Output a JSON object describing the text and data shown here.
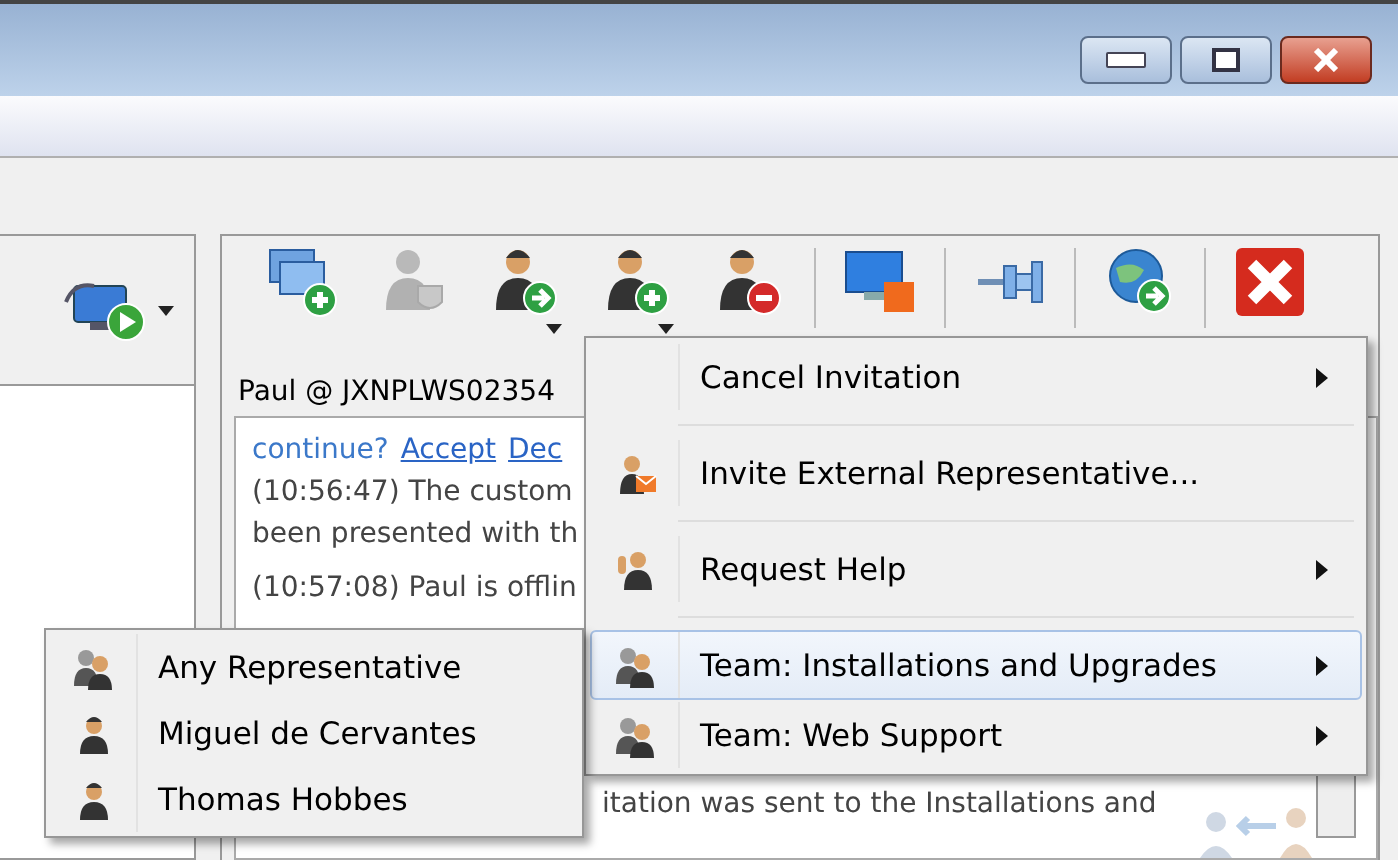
{
  "window": {
    "buttons": [
      {
        "kind": "minimize"
      },
      {
        "kind": "maximize"
      },
      {
        "kind": "close"
      }
    ]
  },
  "left_toolbar": {
    "dropdown": true
  },
  "toolbar": [
    {
      "kind": "new-session",
      "dropdown": false,
      "disabled": false
    },
    {
      "kind": "person-shield",
      "dropdown": false,
      "disabled": true
    },
    {
      "kind": "person-transfer",
      "dropdown": true,
      "disabled": false
    },
    {
      "kind": "person-add",
      "dropdown": true,
      "disabled": false
    },
    {
      "kind": "person-remove",
      "dropdown": false,
      "disabled": false
    },
    {
      "kind": "screen",
      "dropdown": false,
      "disabled": false
    },
    {
      "kind": "pin",
      "dropdown": false,
      "disabled": false
    },
    {
      "kind": "globe",
      "dropdown": false,
      "disabled": false
    },
    {
      "kind": "close",
      "dropdown": false,
      "disabled": false
    }
  ],
  "session": {
    "title": "Paul @ JXNPLWS02354"
  },
  "chat": {
    "lines": [
      {
        "kind": "prompt",
        "text": "continue?",
        "accept": "Accept",
        "decline": "Dec"
      },
      {
        "kind": "message",
        "text": "(10:56:47) The custom"
      },
      {
        "kind": "message",
        "text": "been presented with th"
      },
      {
        "kind": "message",
        "text": "(10:57:08) Paul is offlin"
      }
    ],
    "tail": "itation was sent to the Installations and"
  },
  "context_menu": {
    "items": [
      {
        "kind": "plain",
        "label": "Cancel Invitation",
        "submenu": true,
        "selected": false
      },
      {
        "kind": "email",
        "label": "Invite External Representative...",
        "submenu": false,
        "selected": false
      },
      {
        "kind": "help",
        "label": "Request Help",
        "submenu": true,
        "selected": false
      },
      {
        "kind": "team",
        "label": "Team: Installations and Upgrades",
        "submenu": true,
        "selected": true
      },
      {
        "kind": "team",
        "label": "Team: Web Support",
        "submenu": true,
        "selected": false
      }
    ]
  },
  "submenu": {
    "items": [
      {
        "kind": "team",
        "label": "Any Representative"
      },
      {
        "kind": "person",
        "label": "Miguel de Cervantes"
      },
      {
        "kind": "person",
        "label": "Thomas Hobbes"
      }
    ]
  }
}
